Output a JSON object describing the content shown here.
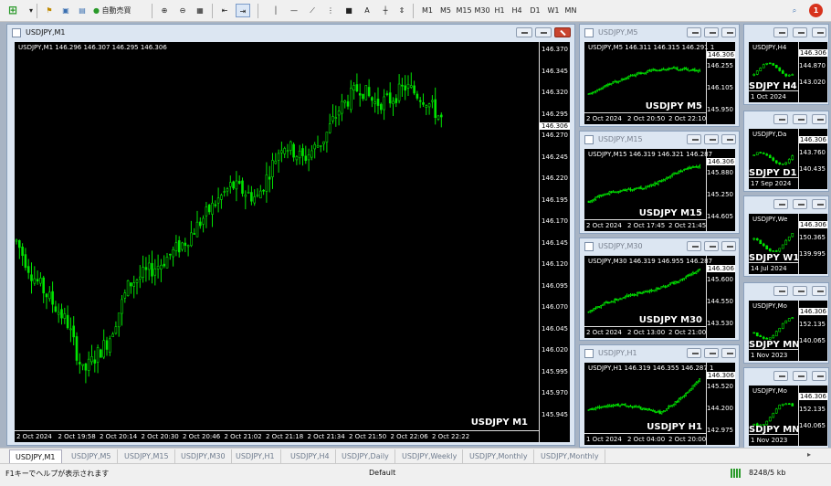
{
  "toolbar": {
    "auto_trade_label": "自動売買",
    "text_tool": "A",
    "timeframes": [
      "M1",
      "M5",
      "M15",
      "M30",
      "H1",
      "H4",
      "D1",
      "W1",
      "MN"
    ],
    "notification_count": "1"
  },
  "main": {
    "title": "USDJPY,M1",
    "header": "USDJPY,M1  146.296 146.307 146.295 146.306",
    "watermark": "USDJPY M1",
    "current_price": "146.306",
    "price_labels": [
      "146.370",
      "146.345",
      "146.320",
      "146.295",
      "146.270",
      "146.245",
      "146.220",
      "146.195",
      "146.170",
      "146.145",
      "146.120",
      "146.095",
      "146.070",
      "146.045",
      "146.020",
      "145.995",
      "145.970",
      "145.945"
    ],
    "time_labels": [
      "2 Oct 2024",
      "2 Oct 19:58",
      "2 Oct 20:14",
      "2 Oct 20:30",
      "2 Oct 20:46",
      "2 Oct 21:02",
      "2 Oct 21:18",
      "2 Oct 21:34",
      "2 Oct 21:50",
      "2 Oct 22:06",
      "2 Oct 22:22"
    ]
  },
  "mid_windows": [
    {
      "title": "USDJPY,M5",
      "header": "USDJPY,M5  146.311 146.315 146.291 1",
      "watermark": "USDJPY M5",
      "current": "146.306",
      "prices": [
        "146.255",
        "146.105",
        "145.950"
      ],
      "times": [
        "2 Oct 2024",
        "2 Oct 20:50",
        "2 Oct 22:10"
      ]
    },
    {
      "title": "USDJPY,M15",
      "header": "USDJPY,M15  146.319 146.321 146.287",
      "watermark": "USDJPY M15",
      "current": "146.306",
      "prices": [
        "145.880",
        "145.250",
        "144.605"
      ],
      "times": [
        "2 Oct 2024",
        "2 Oct 17:45",
        "2 Oct 21:45"
      ]
    },
    {
      "title": "USDJPY,M30",
      "header": "USDJPY,M30  146.319 146.955 146.287",
      "watermark": "USDJPY M30",
      "current": "146.306",
      "prices": [
        "145.600",
        "144.550",
        "143.530"
      ],
      "times": [
        "2 Oct 2024",
        "2 Oct 13:00",
        "2 Oct 21:00"
      ]
    },
    {
      "title": "USDJPY,H1",
      "header": "USDJPY,H1  146.319 146.355 146.287 1",
      "watermark": "USDJPY H1",
      "current": "146.306",
      "prices": [
        "145.520",
        "144.200",
        "142.975"
      ],
      "times": [
        "1 Oct 2024",
        "2 Oct 04:00",
        "2 Oct 20:00"
      ]
    }
  ],
  "right_windows": [
    {
      "header": "USDJPY,H4",
      "watermark": "SDJPY H4",
      "current": "146.306",
      "prices": [
        "144.870",
        "143.020"
      ],
      "time": "1 Oct 2024"
    },
    {
      "header": "USDJPY,Da",
      "watermark": "SDJPY D1",
      "current": "146.306",
      "prices": [
        "143.760",
        "140.435"
      ],
      "time": "17 Sep 2024"
    },
    {
      "header": "USDJPY,We",
      "watermark": "SDJPY W1",
      "current": "146.306",
      "prices": [
        "150.365",
        "139.995"
      ],
      "time": "14 Jul 2024"
    },
    {
      "header": "USDJPY,Mo",
      "watermark": "SDJPY MN",
      "current": "146.306",
      "prices": [
        "152.135",
        "140.065"
      ],
      "time": "1 Nov 2023"
    },
    {
      "header": "USDJPY,Mo",
      "watermark": "SDJPY MN",
      "current": "146.306",
      "prices": [
        "152.135",
        "140.065"
      ],
      "time": "1 Nov 2023"
    }
  ],
  "tabs": [
    "USDJPY,M1",
    "USDJPY,M5",
    "USDJPY,M15",
    "USDJPY,M30",
    "USDJPY,H1",
    "USDJPY,H4",
    "USDJPY,Daily",
    "USDJPY,Weekly",
    "USDJPY,Monthly",
    "USDJPY,Monthly"
  ],
  "status": {
    "help": "F1キーでヘルプが表示されます",
    "profile": "Default",
    "traffic": "8248/5 kb"
  },
  "colors": {
    "candle": "#00e400",
    "chart_bg": "#000000",
    "accent": "#1e5aa8"
  }
}
